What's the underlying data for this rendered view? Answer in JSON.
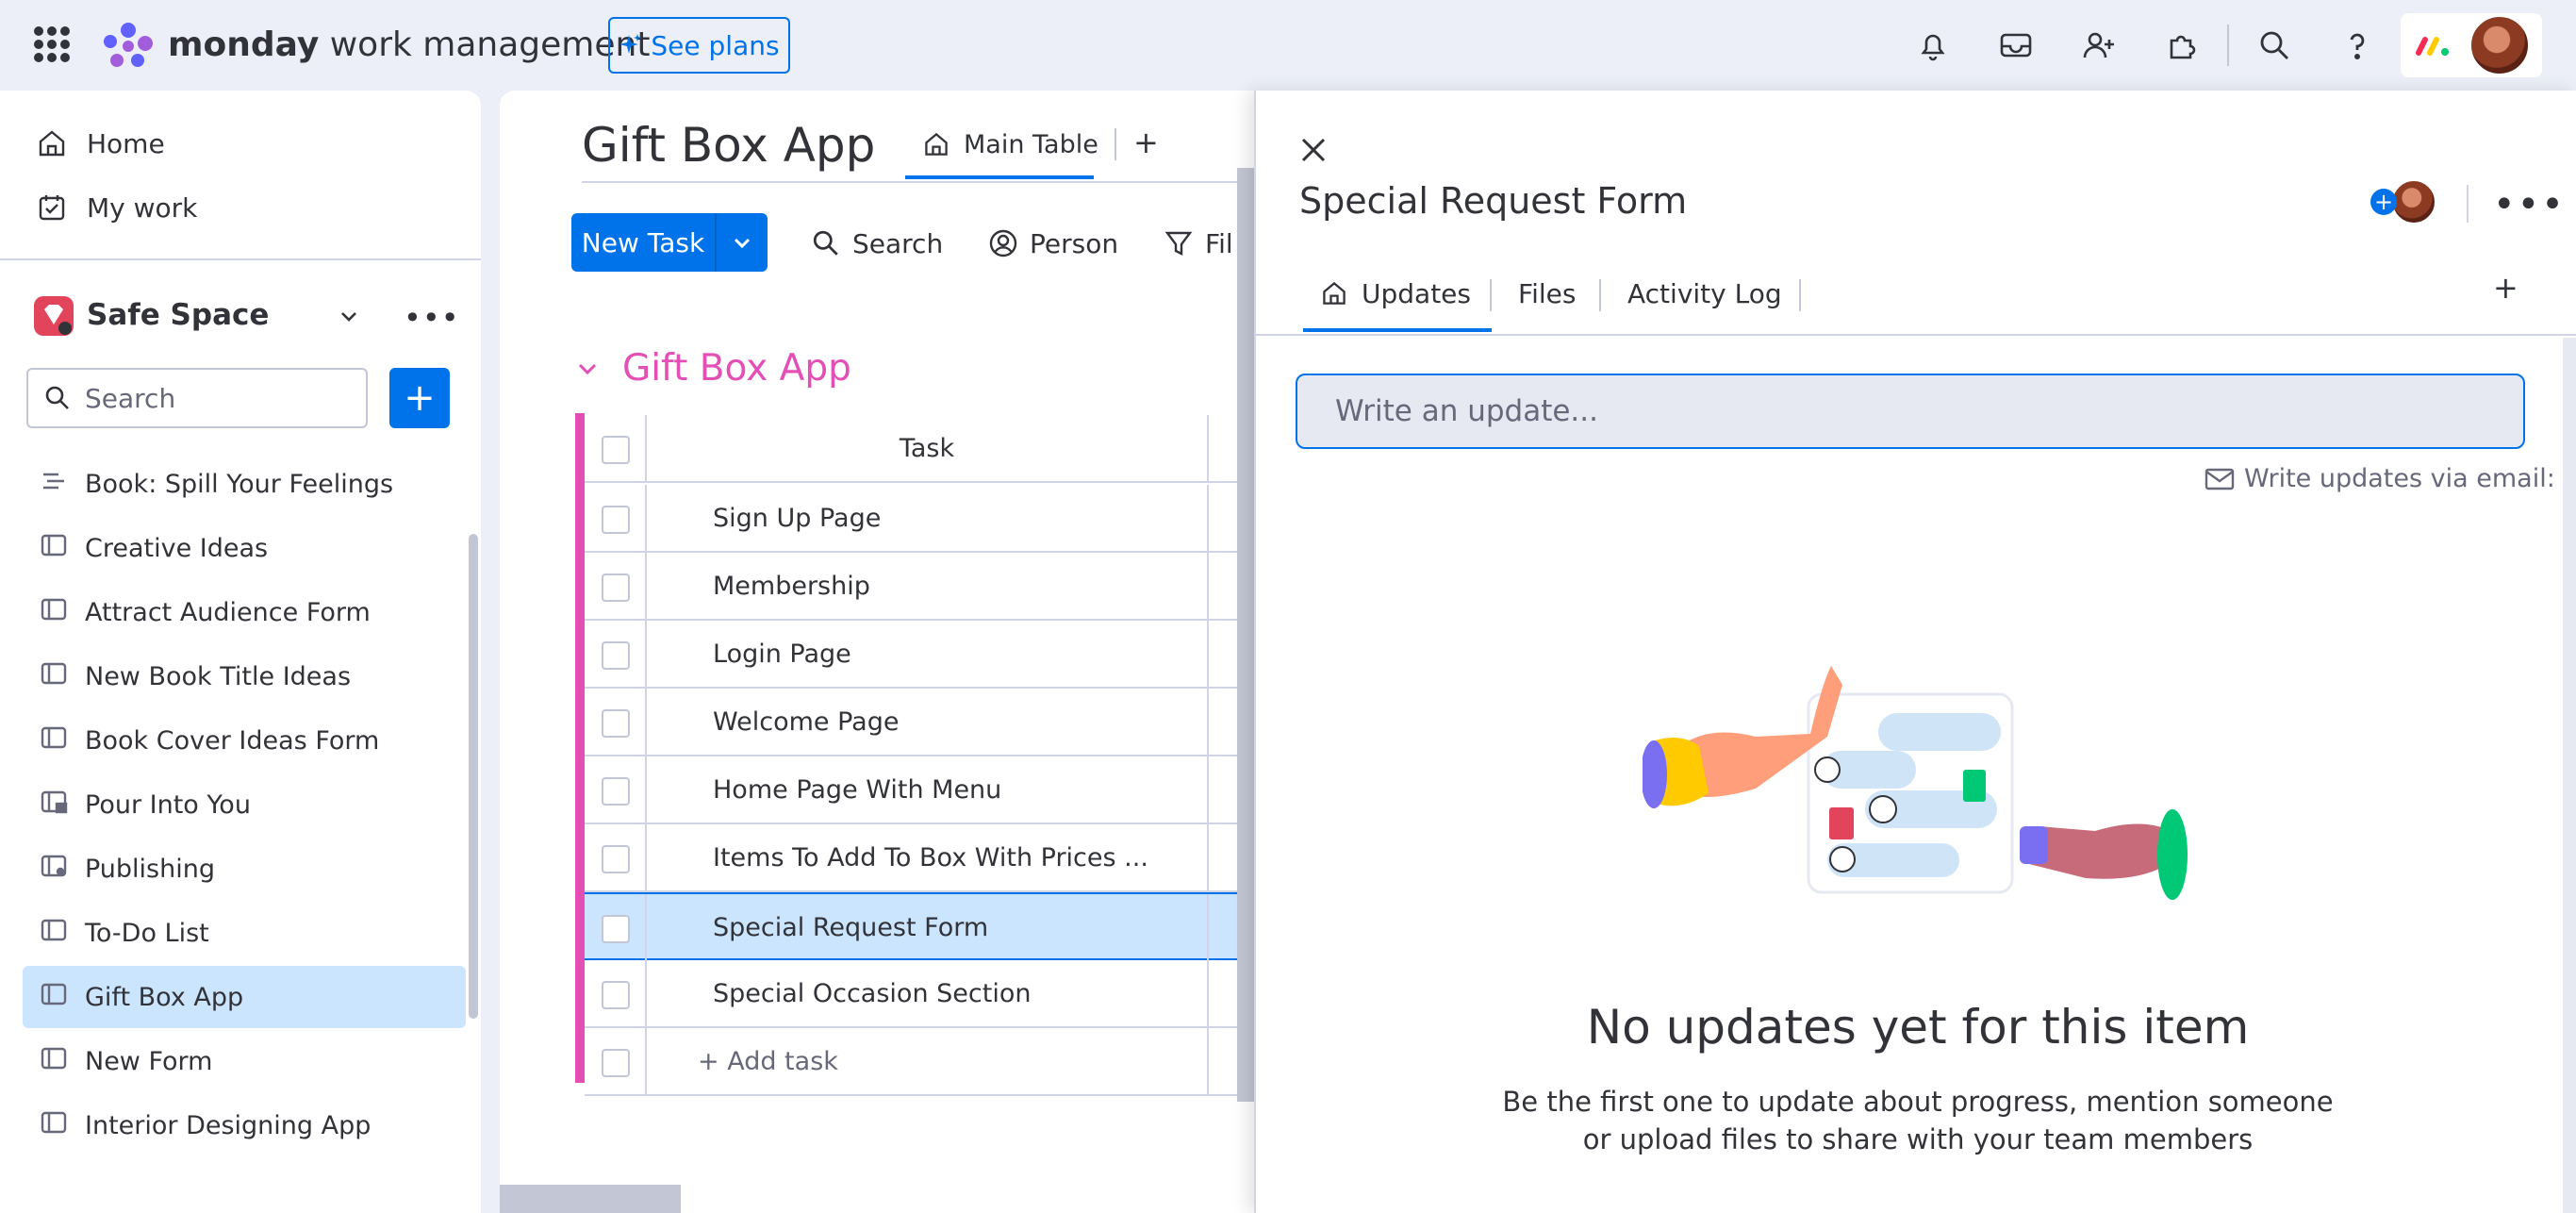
{
  "topbar": {
    "brand_bold": "monday",
    "brand_rest": " work management",
    "see_plans": "See plans"
  },
  "sidebar": {
    "home": "Home",
    "my_work": "My work",
    "workspace": "Safe Space",
    "search_placeholder": "Search",
    "add": "+",
    "boards": [
      {
        "label": "Book: Spill Your Feelings",
        "icon": "list-icon"
      },
      {
        "label": "Creative Ideas",
        "icon": "board-icon"
      },
      {
        "label": "Attract Audience Form",
        "icon": "board-icon"
      },
      {
        "label": "New Book Title Ideas",
        "icon": "board-icon"
      },
      {
        "label": "Book Cover Ideas Form",
        "icon": "board-icon"
      },
      {
        "label": "Pour Into You",
        "icon": "board-lock-icon"
      },
      {
        "label": "Publishing",
        "icon": "board-share-icon"
      },
      {
        "label": "To-Do List",
        "icon": "board-icon"
      },
      {
        "label": "Gift Box App",
        "icon": "board-icon",
        "active": true
      },
      {
        "label": "New Form",
        "icon": "board-icon"
      },
      {
        "label": "Interior Designing App",
        "icon": "board-icon"
      }
    ]
  },
  "main": {
    "title": "Gift Box App",
    "tab_main": "Main Table",
    "tab_plus": "+",
    "new_task": "New Task",
    "search": "Search",
    "person": "Person",
    "filter": "Fil",
    "group_title": "Gift Box App",
    "column_task": "Task",
    "rows": [
      "Sign Up Page",
      "Membership",
      "Login Page",
      "Welcome Page",
      "Home Page With Menu",
      "Items To Add To Box With Prices ...",
      "Special Request Form",
      "Special Occasion Section"
    ],
    "selected_row": 6,
    "add_task": "+ Add task"
  },
  "panel": {
    "title": "Special Request Form",
    "more": "...",
    "tabs": [
      "Updates",
      "Files",
      "Activity Log"
    ],
    "tab_plus": "+",
    "update_placeholder": "Write an update...",
    "email_text": "Write updates via email:",
    "empty_title": "No updates yet for this item",
    "empty_line1": "Be the first one to update about progress, mention someone",
    "empty_line2": "or upload files to share with your team members"
  },
  "colors": {
    "accent": "#0073ea",
    "group": "#e44fb5",
    "selected_row": "#cce5ff"
  }
}
